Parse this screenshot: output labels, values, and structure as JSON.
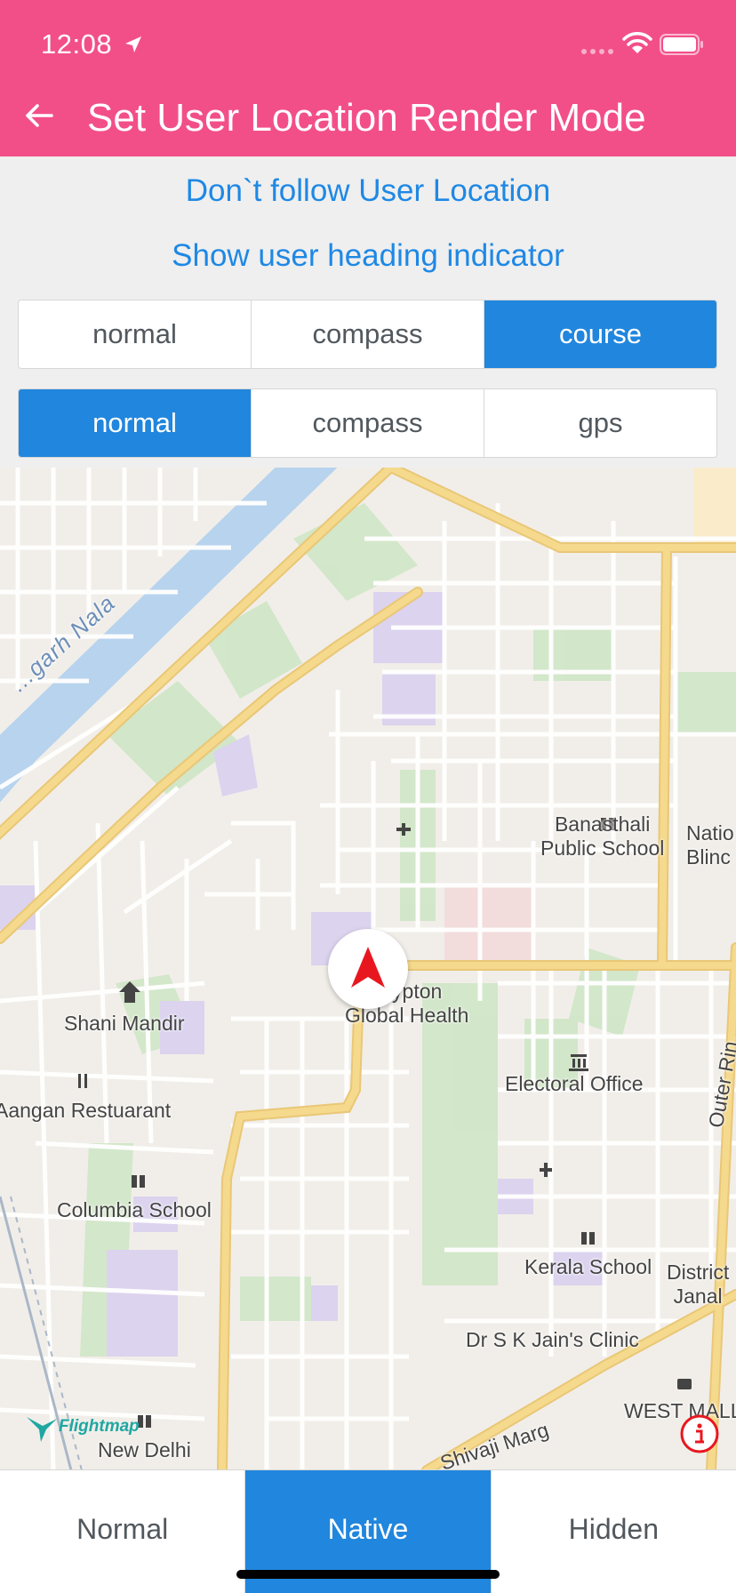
{
  "status_bar": {
    "time": "12:08"
  },
  "header": {
    "title": "Set User Location Render Mode"
  },
  "links": {
    "follow": "Don`t follow User Location",
    "heading": "Show user heading indicator"
  },
  "segment_top": {
    "options": [
      "normal",
      "compass",
      "course"
    ],
    "selected": "course"
  },
  "segment_mid": {
    "options": [
      "normal",
      "compass",
      "gps"
    ],
    "selected": "normal"
  },
  "map": {
    "labels": {
      "nala": "…garh Nala",
      "banasthali": "Banasthali\nPublic School",
      "national": "Natio\nBlinc",
      "krypton": "Krypton\nGlobal Health",
      "shani": "Shani Mandir",
      "electoral": "Electoral Office",
      "aangan": "Aangan Restuarant",
      "outer_ring": "Outer Rin…",
      "columbia": "Columbia School",
      "kerala": "Kerala School",
      "district": "District\nJanal",
      "drsk": "Dr S K Jain's Clinic",
      "westmall": "WEST MALL",
      "newdelhi": "New Delhi",
      "shivaji": "Shivaji Marg"
    },
    "attribution": "Flightmap",
    "accent_road": "#f5d98c",
    "water": "#b7d3ee",
    "park": "#cfe6c6"
  },
  "bottom_tabs": {
    "options": [
      "Normal",
      "Native",
      "Hidden"
    ],
    "selected": "Native"
  }
}
